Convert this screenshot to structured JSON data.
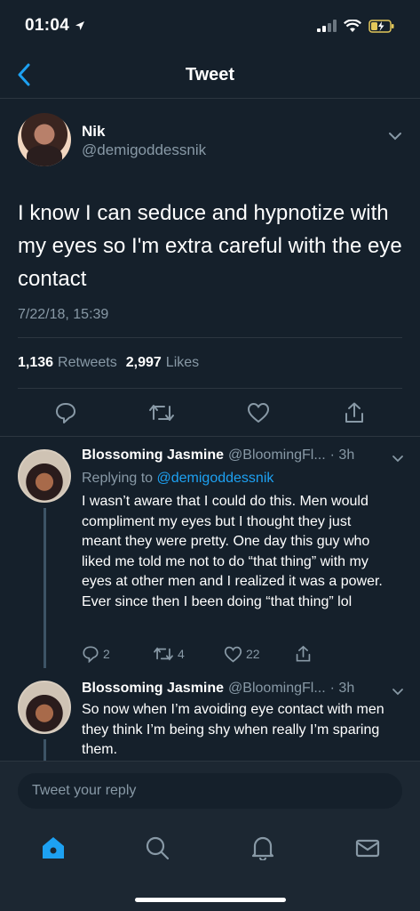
{
  "status_bar": {
    "time": "01:04"
  },
  "header": {
    "title": "Tweet"
  },
  "main_tweet": {
    "name": "Nik",
    "handle": "@demigoddessnik",
    "text": "I know I can seduce and hypnotize with my eyes so I'm extra careful with the eye contact",
    "timestamp": "7/22/18, 15:39",
    "retweets_count": "1,136",
    "retweets_label": "Retweets",
    "likes_count": "2,997",
    "likes_label": "Likes"
  },
  "replies": [
    {
      "name": "Blossoming Jasmine",
      "handle": "@BloomingFl...",
      "time": "· 3h",
      "replying_prefix": "Replying to",
      "replying_to": "@demigoddessnik",
      "text": "I wasn’t aware that I could do this. Men would compliment my eyes but I thought they just meant they were pretty. One day this guy who liked me told me not to do “that thing” with my eyes at other men and I realized it was a power. Ever since then I been doing “that thing” lol",
      "reply_count": "2",
      "retweet_count": "4",
      "like_count": "22"
    },
    {
      "name": "Blossoming Jasmine",
      "handle": "@BloomingFl...",
      "time": "· 3h",
      "text": "So now when I’m avoiding eye contact with men they think I’m being shy when really I’m sparing them."
    }
  ],
  "compose": {
    "placeholder": "Tweet your reply"
  },
  "colors": {
    "background": "#15202b",
    "accent": "#1da1f2",
    "muted": "#8899a6",
    "bar": "#1c2732"
  }
}
